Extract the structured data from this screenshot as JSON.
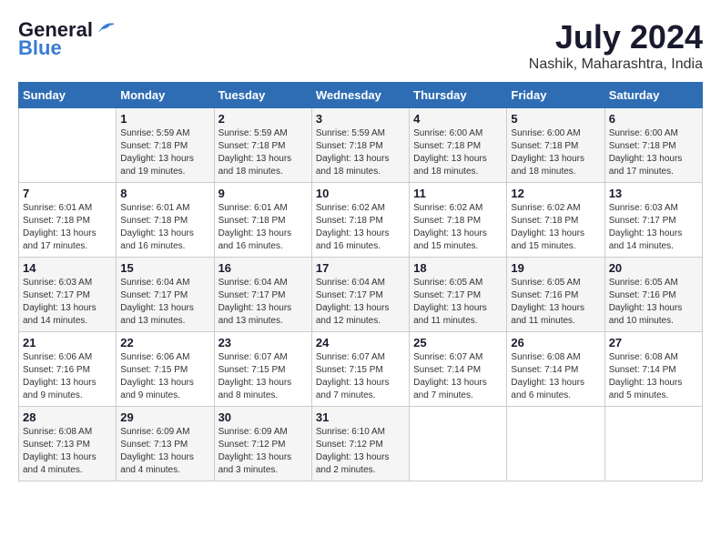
{
  "header": {
    "logo_general": "General",
    "logo_blue": "Blue",
    "month": "July 2024",
    "location": "Nashik, Maharashtra, India"
  },
  "weekdays": [
    "Sunday",
    "Monday",
    "Tuesday",
    "Wednesday",
    "Thursday",
    "Friday",
    "Saturday"
  ],
  "weeks": [
    [
      {
        "day": "",
        "info": ""
      },
      {
        "day": "1",
        "info": "Sunrise: 5:59 AM\nSunset: 7:18 PM\nDaylight: 13 hours\nand 19 minutes."
      },
      {
        "day": "2",
        "info": "Sunrise: 5:59 AM\nSunset: 7:18 PM\nDaylight: 13 hours\nand 18 minutes."
      },
      {
        "day": "3",
        "info": "Sunrise: 5:59 AM\nSunset: 7:18 PM\nDaylight: 13 hours\nand 18 minutes."
      },
      {
        "day": "4",
        "info": "Sunrise: 6:00 AM\nSunset: 7:18 PM\nDaylight: 13 hours\nand 18 minutes."
      },
      {
        "day": "5",
        "info": "Sunrise: 6:00 AM\nSunset: 7:18 PM\nDaylight: 13 hours\nand 18 minutes."
      },
      {
        "day": "6",
        "info": "Sunrise: 6:00 AM\nSunset: 7:18 PM\nDaylight: 13 hours\nand 17 minutes."
      }
    ],
    [
      {
        "day": "7",
        "info": ""
      },
      {
        "day": "8",
        "info": "Sunrise: 6:01 AM\nSunset: 7:18 PM\nDaylight: 13 hours\nand 16 minutes."
      },
      {
        "day": "9",
        "info": "Sunrise: 6:01 AM\nSunset: 7:18 PM\nDaylight: 13 hours\nand 16 minutes."
      },
      {
        "day": "10",
        "info": "Sunrise: 6:02 AM\nSunset: 7:18 PM\nDaylight: 13 hours\nand 16 minutes."
      },
      {
        "day": "11",
        "info": "Sunrise: 6:02 AM\nSunset: 7:18 PM\nDaylight: 13 hours\nand 15 minutes."
      },
      {
        "day": "12",
        "info": "Sunrise: 6:02 AM\nSunset: 7:18 PM\nDaylight: 13 hours\nand 15 minutes."
      },
      {
        "day": "13",
        "info": "Sunrise: 6:03 AM\nSunset: 7:17 PM\nDaylight: 13 hours\nand 14 minutes."
      }
    ],
    [
      {
        "day": "14",
        "info": ""
      },
      {
        "day": "15",
        "info": "Sunrise: 6:04 AM\nSunset: 7:17 PM\nDaylight: 13 hours\nand 13 minutes."
      },
      {
        "day": "16",
        "info": "Sunrise: 6:04 AM\nSunset: 7:17 PM\nDaylight: 13 hours\nand 13 minutes."
      },
      {
        "day": "17",
        "info": "Sunrise: 6:04 AM\nSunset: 7:17 PM\nDaylight: 13 hours\nand 12 minutes."
      },
      {
        "day": "18",
        "info": "Sunrise: 6:05 AM\nSunset: 7:17 PM\nDaylight: 13 hours\nand 11 minutes."
      },
      {
        "day": "19",
        "info": "Sunrise: 6:05 AM\nSunset: 7:16 PM\nDaylight: 13 hours\nand 11 minutes."
      },
      {
        "day": "20",
        "info": "Sunrise: 6:05 AM\nSunset: 7:16 PM\nDaylight: 13 hours\nand 10 minutes."
      }
    ],
    [
      {
        "day": "21",
        "info": ""
      },
      {
        "day": "22",
        "info": "Sunrise: 6:06 AM\nSunset: 7:15 PM\nDaylight: 13 hours\nand 9 minutes."
      },
      {
        "day": "23",
        "info": "Sunrise: 6:07 AM\nSunset: 7:15 PM\nDaylight: 13 hours\nand 8 minutes."
      },
      {
        "day": "24",
        "info": "Sunrise: 6:07 AM\nSunset: 7:15 PM\nDaylight: 13 hours\nand 7 minutes."
      },
      {
        "day": "25",
        "info": "Sunrise: 6:07 AM\nSunset: 7:14 PM\nDaylight: 13 hours\nand 7 minutes."
      },
      {
        "day": "26",
        "info": "Sunrise: 6:08 AM\nSunset: 7:14 PM\nDaylight: 13 hours\nand 6 minutes."
      },
      {
        "day": "27",
        "info": "Sunrise: 6:08 AM\nSunset: 7:14 PM\nDaylight: 13 hours\nand 5 minutes."
      }
    ],
    [
      {
        "day": "28",
        "info": "Sunrise: 6:08 AM\nSunset: 7:13 PM\nDaylight: 13 hours\nand 4 minutes."
      },
      {
        "day": "29",
        "info": "Sunrise: 6:09 AM\nSunset: 7:13 PM\nDaylight: 13 hours\nand 4 minutes."
      },
      {
        "day": "30",
        "info": "Sunrise: 6:09 AM\nSunset: 7:12 PM\nDaylight: 13 hours\nand 3 minutes."
      },
      {
        "day": "31",
        "info": "Sunrise: 6:10 AM\nSunset: 7:12 PM\nDaylight: 13 hours\nand 2 minutes."
      },
      {
        "day": "",
        "info": ""
      },
      {
        "day": "",
        "info": ""
      },
      {
        "day": "",
        "info": ""
      }
    ]
  ],
  "week7_sunday": {
    "day": "7",
    "info": "Sunrise: 6:01 AM\nSunset: 7:18 PM\nDaylight: 13 hours\nand 17 minutes."
  },
  "week3_sunday": {
    "day": "14",
    "info": "Sunrise: 6:03 AM\nSunset: 7:17 PM\nDaylight: 13 hours\nand 14 minutes."
  },
  "week4_sunday": {
    "day": "21",
    "info": "Sunrise: 6:06 AM\nSunset: 7:16 PM\nDaylight: 13 hours\nand 9 minutes."
  }
}
